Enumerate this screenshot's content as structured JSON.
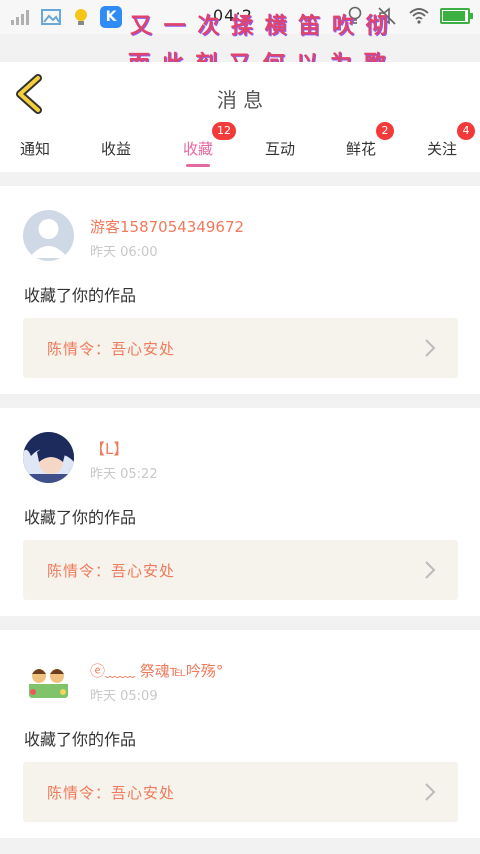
{
  "statusbar": {
    "time": "04:2",
    "k_label": "K"
  },
  "overlay": {
    "line1": "又 一 次 揉 横 笛 吹 彻",
    "line2": "而 此 刻 又 何 以 为 歌"
  },
  "header": {
    "title": "消 息"
  },
  "tabs": [
    {
      "label": "通知",
      "badge": ""
    },
    {
      "label": "收益",
      "badge": ""
    },
    {
      "label": "收藏",
      "badge": "12"
    },
    {
      "label": "互动",
      "badge": ""
    },
    {
      "label": "鲜花",
      "badge": "2"
    },
    {
      "label": "关注",
      "badge": "4"
    }
  ],
  "items": [
    {
      "username": "游客1587054349672",
      "time": "昨天 06:00",
      "action": "收藏了你的作品",
      "work": "陈情令：吾心安处"
    },
    {
      "username": "【L】",
      "time": "昨天 05:22",
      "action": "收藏了你的作品",
      "work": "陈情令：吾心安处"
    },
    {
      "username": "ⓔ﹏﹏ 祭魂℡吟殇°",
      "time": "昨天 05:09",
      "action": "收藏了你的作品",
      "work": "陈情令：吾心安处"
    }
  ],
  "colors": {
    "accent": "#e46aa0",
    "name": "#f07a5b",
    "badge": "#f33a3a"
  }
}
